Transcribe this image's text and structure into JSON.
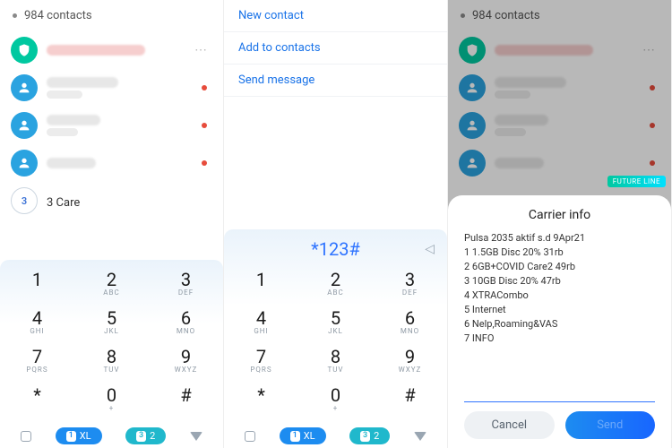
{
  "header": {
    "contact_count": "984 contacts"
  },
  "contacts_visible": {
    "last_named": "3 Care"
  },
  "menu": {
    "new_contact": "New contact",
    "add_to_contacts": "Add to contacts",
    "send_message": "Send message"
  },
  "dialer": {
    "entered": "*123#",
    "keys": [
      {
        "num": "1",
        "sub": ""
      },
      {
        "num": "2",
        "sub": "ABC"
      },
      {
        "num": "3",
        "sub": "DEF"
      },
      {
        "num": "4",
        "sub": "GHI"
      },
      {
        "num": "5",
        "sub": "JKL"
      },
      {
        "num": "6",
        "sub": "MNO"
      },
      {
        "num": "7",
        "sub": "PQRS"
      },
      {
        "num": "8",
        "sub": "TUV"
      },
      {
        "num": "9",
        "sub": "WXYZ"
      },
      {
        "num": "*",
        "sub": ""
      },
      {
        "num": "0",
        "sub": "+"
      },
      {
        "num": "#",
        "sub": ""
      }
    ]
  },
  "sim": {
    "sim1_index": "1",
    "sim1_label": "XL",
    "sim2_index": "3",
    "sim2_label": "2"
  },
  "future_tag": "FUTURE LINE",
  "dialog": {
    "title": "Carrier info",
    "body": "Pulsa 2035 aktif s.d 9Apr21\n1 1.5GB Disc 20% 31rb\n2 6GB+COVID Care2 49rb\n3 10GB Disc 20% 47rb\n4 XTRACombo\n5 Internet\n6 Nelp,Roaming&VAS\n7 INFO",
    "cancel": "Cancel",
    "send": "Send"
  }
}
